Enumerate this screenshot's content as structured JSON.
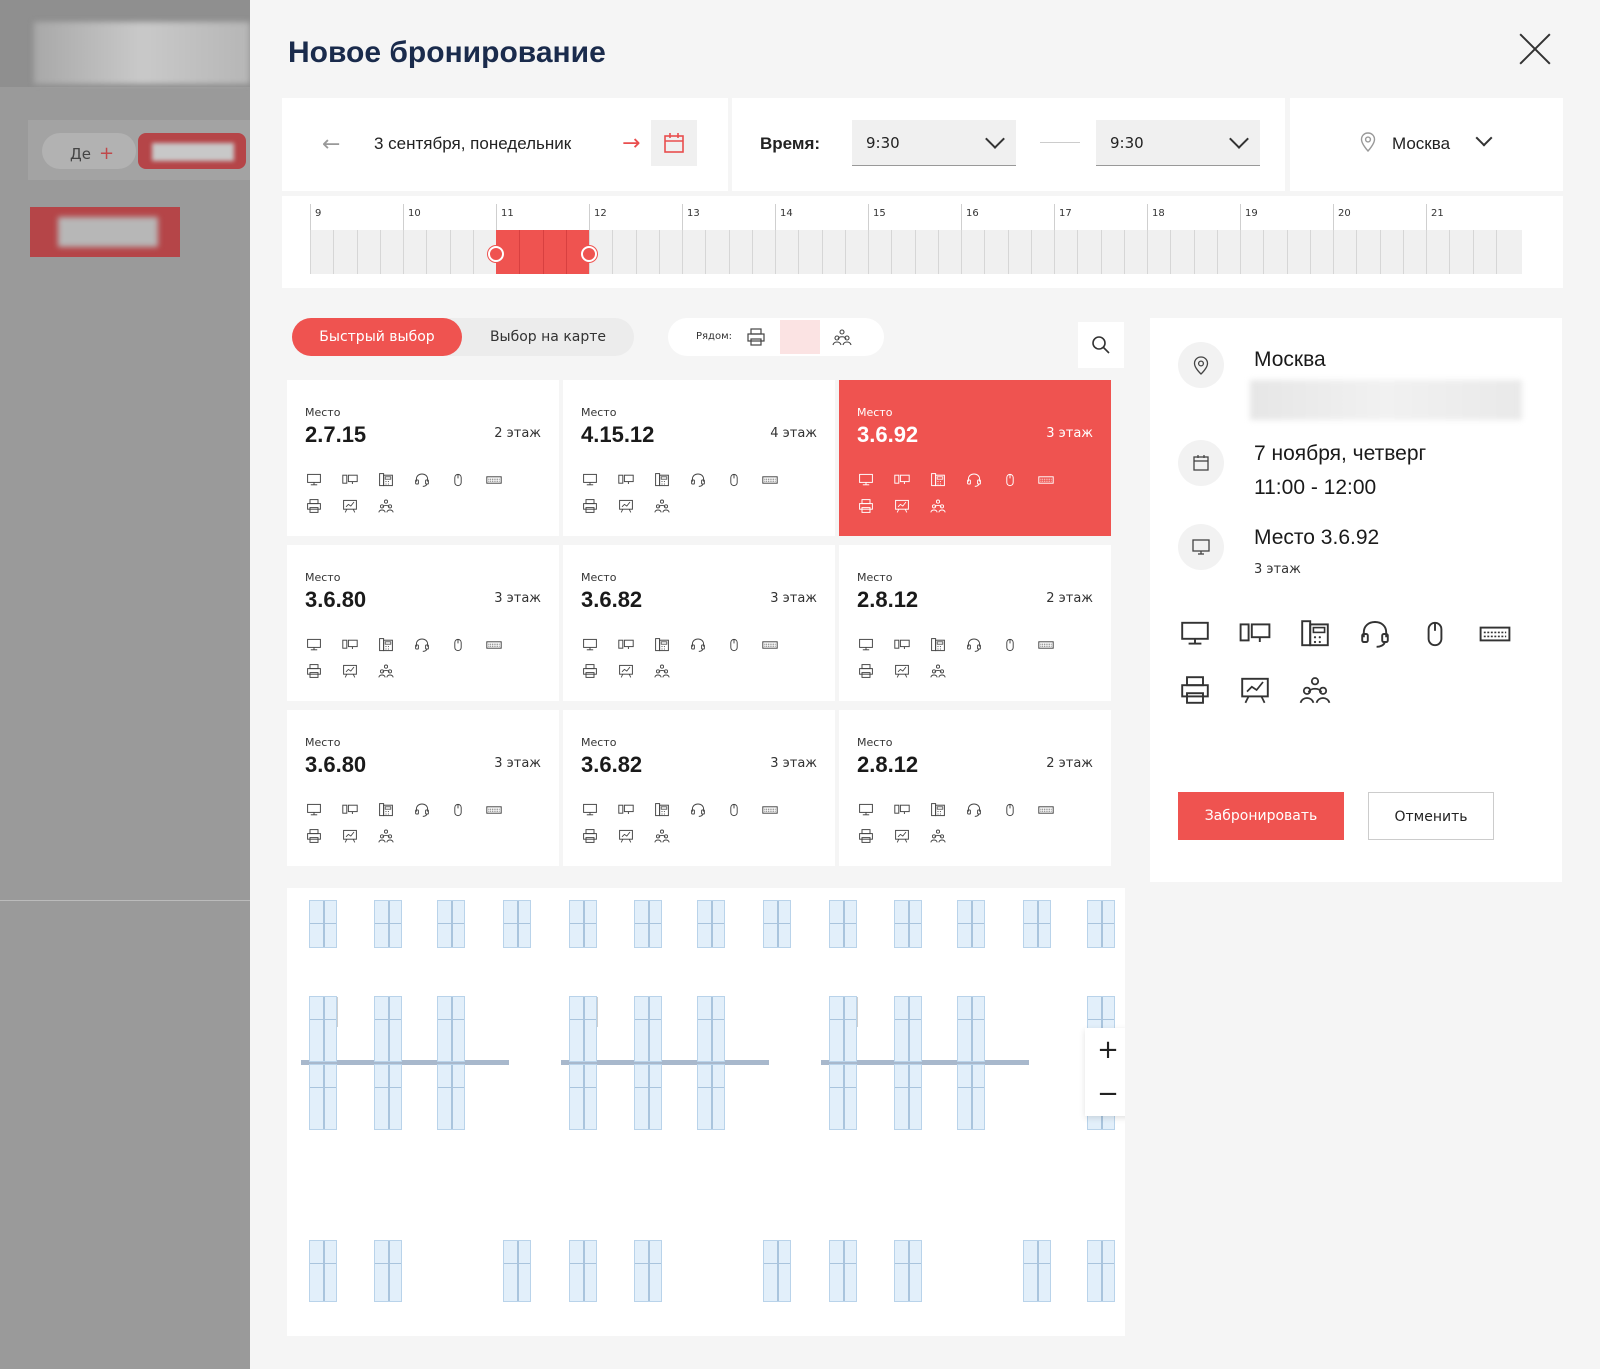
{
  "backdrop": {
    "pill_label": "Де",
    "pill_plus": "+"
  },
  "modal": {
    "title": "Новое бронирование",
    "date": {
      "text": "3 сентября, понедельник"
    },
    "time": {
      "label": "Время:",
      "from": "9:30",
      "to": "9:30"
    },
    "city": "Москва",
    "timeline": {
      "hours": [
        "9",
        "10",
        "11",
        "12",
        "13",
        "14",
        "15",
        "16",
        "17",
        "18",
        "19",
        "20",
        "21"
      ],
      "selected_start": "11:00",
      "selected_end": "12:00"
    },
    "mode": {
      "quick": "Быстрый выбор",
      "map": "Выбор на карте"
    },
    "nearby": {
      "label": "Рядом:"
    },
    "cards": [
      {
        "label": "Место",
        "number": "2.7.15",
        "floor": "2 этаж",
        "selected": false
      },
      {
        "label": "Место",
        "number": "4.15.12",
        "floor": "4 этаж",
        "selected": false
      },
      {
        "label": "Место",
        "number": "3.6.92",
        "floor": "3 этаж",
        "selected": true
      },
      {
        "label": "Место",
        "number": "3.6.80",
        "floor": "3 этаж",
        "selected": false
      },
      {
        "label": "Место",
        "number": "3.6.82",
        "floor": "3 этаж",
        "selected": false
      },
      {
        "label": "Место",
        "number": "2.8.12",
        "floor": "2 этаж",
        "selected": false
      },
      {
        "label": "Место",
        "number": "3.6.80",
        "floor": "3 этаж",
        "selected": false
      },
      {
        "label": "Место",
        "number": "3.6.82",
        "floor": "3 этаж",
        "selected": false
      },
      {
        "label": "Место",
        "number": "2.8.12",
        "floor": "2 этаж",
        "selected": false
      }
    ],
    "equipment_icons": [
      "monitor-icon",
      "computer-icon",
      "phone-icon",
      "headset-icon",
      "mouse-icon",
      "keyboard-icon",
      "printer-icon",
      "presentation-icon",
      "team-icon"
    ],
    "map": {
      "zoom_in": "+",
      "zoom_out": "−"
    },
    "summary": {
      "city": "Москва",
      "date": "7 ноября, четверг",
      "time": "11:00 - 12:00",
      "place": "Место 3.6.92",
      "floor": "3 этаж",
      "book": "Забронировать",
      "cancel": "Отменить"
    },
    "colors": {
      "accent": "#ef5350",
      "title": "#1a2b4c"
    }
  }
}
